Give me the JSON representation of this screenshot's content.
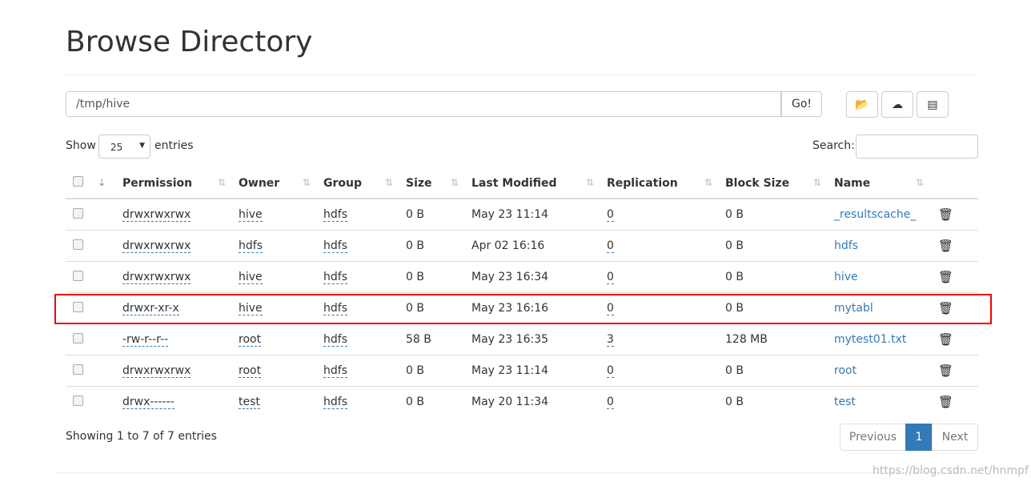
{
  "title": "Browse Directory",
  "path": "/tmp/hive",
  "go_label": "Go!",
  "toolbar": [
    {
      "icon": "folder-open-icon",
      "glyph": "📂"
    },
    {
      "icon": "cloud-upload-icon",
      "glyph": "☁"
    },
    {
      "icon": "list-icon",
      "glyph": "▤"
    }
  ],
  "show_label": "Show",
  "entries_value": "25",
  "entries_label": "entries",
  "search_label": "Search:",
  "columns": [
    "Permission",
    "Owner",
    "Group",
    "Size",
    "Last Modified",
    "Replication",
    "Block Size",
    "Name"
  ],
  "rows": [
    [
      "drwxrwxrwx",
      "hive",
      "hdfs",
      "0 B",
      "May 23 11:14",
      "0",
      "0 B",
      "_resultscache_"
    ],
    [
      "drwxrwxrwx",
      "hdfs",
      "hdfs",
      "0 B",
      "Apr 02 16:16",
      "0",
      "0 B",
      "hdfs"
    ],
    [
      "drwxrwxrwx",
      "hive",
      "hdfs",
      "0 B",
      "May 23 16:34",
      "0",
      "0 B",
      "hive"
    ],
    [
      "drwxr-xr-x",
      "hive",
      "hdfs",
      "0 B",
      "May 23 16:16",
      "0",
      "0 B",
      "mytabl"
    ],
    [
      "-rw-r--r--",
      "root",
      "hdfs",
      "58 B",
      "May 23 16:35",
      "3",
      "128 MB",
      "mytest01.txt"
    ],
    [
      "drwxrwxrwx",
      "root",
      "hdfs",
      "0 B",
      "May 23 11:14",
      "0",
      "0 B",
      "root"
    ],
    [
      "drwx------",
      "test",
      "hdfs",
      "0 B",
      "May 20 11:34",
      "0",
      "0 B",
      "test"
    ]
  ],
  "footer": "Showing 1 to 7 of 7 entries",
  "pagination": {
    "previous": "Previous",
    "page": "1",
    "next": "Next"
  },
  "watermark": "https://blog.csdn.net/hnmpf",
  "colors": {
    "link": "#337ab7",
    "highlight": "#e00000",
    "active_page": "#337ab7"
  }
}
